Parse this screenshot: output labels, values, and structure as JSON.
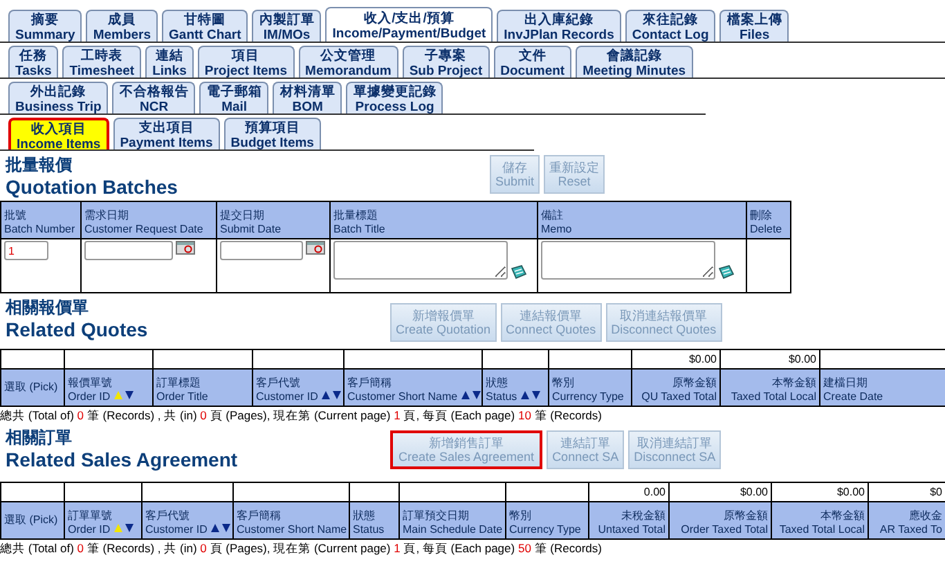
{
  "tab_rows": [
    [
      {
        "zh": "摘要",
        "en": "Summary",
        "selected": false
      },
      {
        "zh": "成員",
        "en": "Members",
        "selected": false
      },
      {
        "zh": "甘特圖",
        "en": "Gantt Chart",
        "selected": false
      },
      {
        "zh": "內製訂單",
        "en": "IM/MOs",
        "selected": false
      },
      {
        "zh": "收入/支出/預算",
        "en": "Income/Payment/Budget",
        "selected": true
      },
      {
        "zh": "出入庫紀錄",
        "en": "InvJPlan Records",
        "selected": false
      },
      {
        "zh": "來往記錄",
        "en": "Contact Log",
        "selected": false
      },
      {
        "zh": "檔案上傳",
        "en": "Files",
        "selected": false
      }
    ],
    [
      {
        "zh": "任務",
        "en": "Tasks",
        "selected": false
      },
      {
        "zh": "工時表",
        "en": "Timesheet",
        "selected": false
      },
      {
        "zh": "連結",
        "en": "Links",
        "selected": false
      },
      {
        "zh": "項目",
        "en": "Project Items",
        "selected": false
      },
      {
        "zh": "公文管理",
        "en": "Memorandum",
        "selected": false
      },
      {
        "zh": "子專案",
        "en": "Sub Project",
        "selected": false
      },
      {
        "zh": "文件",
        "en": "Document",
        "selected": false
      },
      {
        "zh": "會議記錄",
        "en": "Meeting Minutes",
        "selected": false
      }
    ],
    [
      {
        "zh": "外出記錄",
        "en": "Business Trip",
        "selected": false
      },
      {
        "zh": "不合格報告",
        "en": "NCR",
        "selected": false
      },
      {
        "zh": "電子郵箱",
        "en": "Mail",
        "selected": false
      },
      {
        "zh": "材料清單",
        "en": "BOM",
        "selected": false
      },
      {
        "zh": "單據變更記錄",
        "en": "Process Log",
        "selected": false
      }
    ]
  ],
  "sub_tabs": [
    {
      "zh": "收入項目",
      "en": "Income Items",
      "selected": true
    },
    {
      "zh": "支出項目",
      "en": "Payment Items",
      "selected": false
    },
    {
      "zh": "預算項目",
      "en": "Budget Items",
      "selected": false
    }
  ],
  "quotation_batches": {
    "title_zh": "批量報價",
    "title_en": "Quotation Batches",
    "buttons": [
      {
        "zh": "儲存",
        "en": "Submit",
        "highlighted": false
      },
      {
        "zh": "重新設定",
        "en": "Reset",
        "highlighted": false
      }
    ],
    "columns": [
      {
        "zh": "批號",
        "en": "Batch Number",
        "kind": "number"
      },
      {
        "zh": "需求日期",
        "en": "Customer Request Date",
        "kind": "date"
      },
      {
        "zh": "提交日期",
        "en": "Submit Date",
        "kind": "date"
      },
      {
        "zh": "批量標題",
        "en": "Batch Title",
        "kind": "memo"
      },
      {
        "zh": "備註",
        "en": "Memo",
        "kind": "memo"
      },
      {
        "zh": "刪除",
        "en": "Delete",
        "kind": "empty"
      }
    ],
    "batch_number": "1"
  },
  "related_quotes": {
    "title_zh": "相關報價單",
    "title_en": "Related Quotes",
    "buttons": [
      {
        "zh": "新增報價單",
        "en": "Create Quotation",
        "highlighted": false
      },
      {
        "zh": "連結報價單",
        "en": "Connect Quotes",
        "highlighted": false
      },
      {
        "zh": "取消連結報價單",
        "en": "Disconnect Quotes",
        "highlighted": false
      }
    ],
    "columns": [
      {
        "zh": "選取 (Pick)"
      },
      {
        "zh": "報價單號",
        "en": "Order ID",
        "sorted": true
      },
      {
        "zh": "訂單標題",
        "en": "Order Title"
      },
      {
        "zh": "客戶代號",
        "en": "Customer ID",
        "sorted": false
      },
      {
        "zh": "客戶簡稱",
        "en": "Customer Short Name",
        "sorted": false
      },
      {
        "zh": "狀態",
        "en": "Status",
        "sorted": false
      },
      {
        "zh": "幣別",
        "en": "Currency Type"
      },
      {
        "zh": "原幣金額",
        "en": "QU Taxed Total",
        "total": "$0.00"
      },
      {
        "zh": "本幣金額",
        "en": "Taxed Total Local",
        "total": "$0.00"
      },
      {
        "zh": "建檔日期",
        "en": "Create Date"
      }
    ],
    "pager": [
      {
        "text": "總共 (Total of) ",
        "kind": "label"
      },
      {
        "text": "0",
        "kind": "value"
      },
      {
        "text": " 筆 (Records) , 共 (in) ",
        "kind": "label"
      },
      {
        "text": "0",
        "kind": "value"
      },
      {
        "text": " 頁 (Pages), 現在第 (Current page) ",
        "kind": "label"
      },
      {
        "text": "1",
        "kind": "value"
      },
      {
        "text": " 頁, 每頁 (Each page) ",
        "kind": "label"
      },
      {
        "text": "10",
        "kind": "value"
      },
      {
        "text": " 筆 (Records)",
        "kind": "label"
      }
    ]
  },
  "related_sales": {
    "title_zh": "相關訂單",
    "title_en": "Related Sales Agreement",
    "buttons": [
      {
        "zh": "新增銷售訂單",
        "en": "Create Sales Agreement",
        "highlighted": true
      },
      {
        "zh": "連結訂單",
        "en": "Connect SA",
        "highlighted": false
      },
      {
        "zh": "取消連結訂單",
        "en": "Disconnect SA",
        "highlighted": false
      }
    ],
    "columns": [
      {
        "zh": "選取 (Pick)"
      },
      {
        "zh": "訂單單號",
        "en": "Order ID",
        "sorted": true
      },
      {
        "zh": "客戶代號",
        "en": "Customer ID",
        "sorted": false
      },
      {
        "zh": "客戶簡稱",
        "en": "Customer Short Name"
      },
      {
        "zh": "狀態",
        "en": "Status"
      },
      {
        "zh": "訂單預交日期",
        "en": "Main Schedule Date"
      },
      {
        "zh": "幣別",
        "en": "Currency Type"
      },
      {
        "zh": "未稅金額",
        "en": "Untaxed Total",
        "total": "0.00"
      },
      {
        "zh": "原幣金額",
        "en": "Order Taxed Total",
        "total": "$0.00"
      },
      {
        "zh": "本幣金額",
        "en": "Taxed Total Local",
        "total": "$0.00"
      },
      {
        "zh": "應收金",
        "en": "AR Taxed To",
        "total": "$0"
      }
    ],
    "pager": [
      {
        "text": "總共 (Total of) ",
        "kind": "label"
      },
      {
        "text": "0",
        "kind": "value"
      },
      {
        "text": " 筆 (Records) , 共 (in) ",
        "kind": "label"
      },
      {
        "text": "0",
        "kind": "value"
      },
      {
        "text": " 頁 (Pages), 現在第 (Current page) ",
        "kind": "label"
      },
      {
        "text": "1",
        "kind": "value"
      },
      {
        "text": " 頁, 每頁 (Each page) ",
        "kind": "label"
      },
      {
        "text": "50",
        "kind": "value"
      },
      {
        "text": " 筆 (Records)",
        "kind": "label"
      }
    ]
  }
}
